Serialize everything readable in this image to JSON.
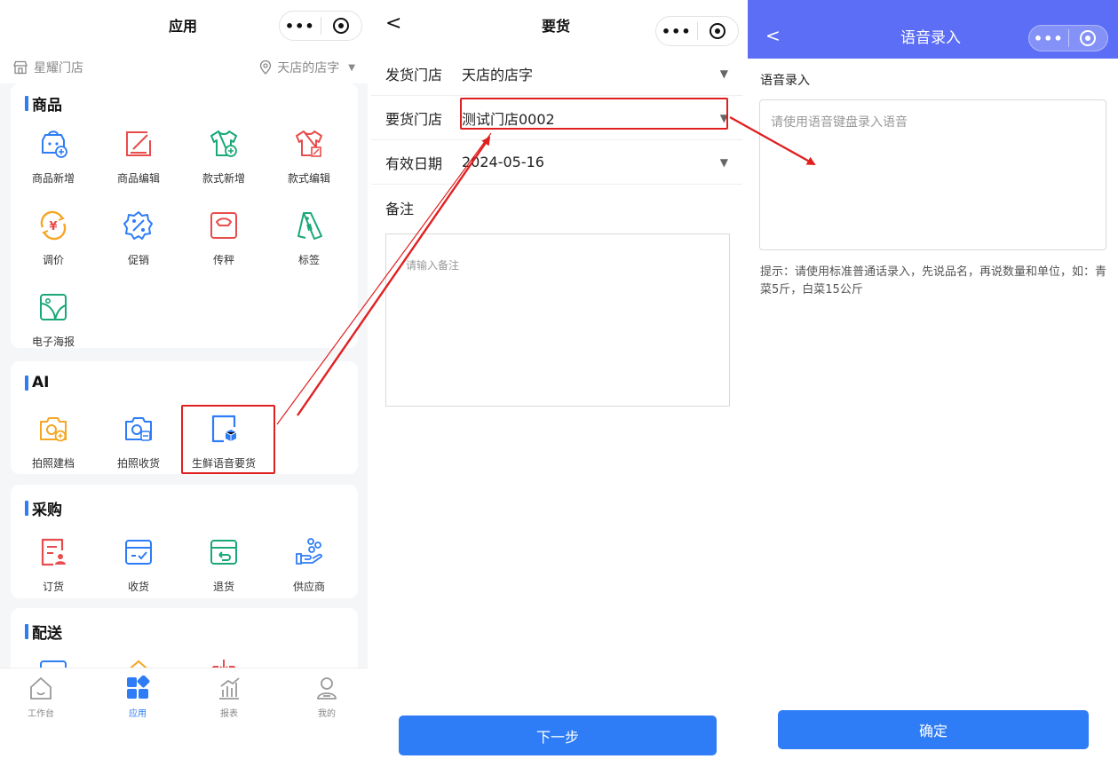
{
  "panel1": {
    "title": "应用",
    "capsule": {
      "more": "•••",
      "close": "target-icon"
    },
    "store_left": "星耀门店",
    "store_right": "天店的店字",
    "sections": [
      {
        "title": "商品",
        "items": [
          "商品新增",
          "商品编辑",
          "款式新增",
          "款式编辑",
          "调价",
          "促销",
          "传秤",
          "标签",
          "电子海报"
        ]
      },
      {
        "title": "AI",
        "items": [
          "拍照建档",
          "拍照收货",
          "生鲜语音要货"
        ]
      },
      {
        "title": "采购",
        "items": [
          "订货",
          "收货",
          "退货",
          "供应商"
        ]
      },
      {
        "title": "配送"
      }
    ],
    "tabs": [
      "工作台",
      "应用",
      "报表",
      "我的"
    ],
    "active_tab": "应用"
  },
  "panel2": {
    "title": "要货",
    "back": "<",
    "rows": [
      {
        "label": "发货门店",
        "value": "天店的店字"
      },
      {
        "label": "要货门店",
        "value": "测试门店0002"
      },
      {
        "label": "有效日期",
        "value": "2024-05-16"
      }
    ],
    "remark_label": "备注",
    "remark_placeholder": "请输入备注",
    "next_button": "下一步"
  },
  "panel3": {
    "title": "语音录入",
    "back": "<",
    "voice_label": "语音录入",
    "voice_placeholder": "请使用语音键盘录入语音",
    "hint": "提示：请使用标准普通话录入，先说品名，再说数量和单位，如：青菜5斤，白菜15公斤",
    "confirm_button": "确定"
  },
  "colors": {
    "accent": "#2e7cf6",
    "header_purple": "#5b6ef5",
    "annotation_red": "#e02020"
  }
}
